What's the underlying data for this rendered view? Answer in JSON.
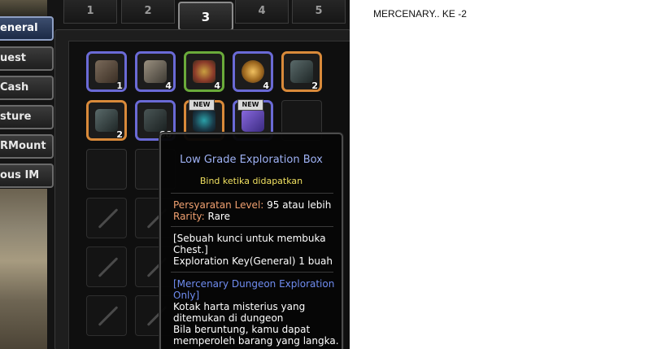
{
  "sidebar": {
    "categories": [
      {
        "label": "eneral",
        "active": true
      },
      {
        "label": "uest"
      },
      {
        "label": "Cash"
      },
      {
        "label": "sture"
      },
      {
        "label": "RMount"
      },
      {
        "label": "ous IM"
      }
    ]
  },
  "tabs": [
    {
      "label": "1"
    },
    {
      "label": "2"
    },
    {
      "label": "3",
      "active": true
    },
    {
      "label": "4"
    },
    {
      "label": "5"
    }
  ],
  "inventory": {
    "row1": [
      {
        "icon": "weapon-box-icon",
        "count": "1",
        "frame": "#6a6ad6"
      },
      {
        "icon": "armor-box-icon",
        "count": "4",
        "frame": "#6a6ad6"
      },
      {
        "icon": "heart-chest-icon",
        "count": "4",
        "frame": "#6aaa3a"
      },
      {
        "icon": "pouch-icon",
        "count": "4",
        "frame": "#6a6ad6"
      },
      {
        "icon": "treasure-chest-icon",
        "count": "2",
        "frame": "#d98a3a"
      }
    ],
    "row2": [
      {
        "icon": "treasure-chest-icon",
        "count": "2",
        "frame": "#d98a3a"
      },
      {
        "icon": "treasure-chest-icon",
        "count": "66",
        "frame": "#6a6ad6"
      },
      {
        "icon": "rune-box-icon",
        "count": "",
        "frame": "#d98a3a",
        "badge": "NEW"
      },
      {
        "icon": "gift-box-icon",
        "count": "",
        "frame": "#6a6ad6",
        "badge": "NEW"
      }
    ]
  },
  "tooltip": {
    "title": "Low Grade Exploration Box",
    "bind": "Bind ketika didapatkan",
    "level_label": "Persyaratan Level:",
    "level_value": "95 atau lebih",
    "rarity_label": "Rarity:",
    "rarity_value": "Rare",
    "desc_1": "[Sebuah kunci untuk membuka",
    "desc_2": "Chest.]",
    "desc_3": "Exploration Key(General) 1 buah",
    "mercenary_1": "[Mercenary Dungeon Exploration",
    "mercenary_2": "Only]",
    "lore_1": "Kotak harta misterius yang",
    "lore_2": "ditemukan di dungeon",
    "lore_3": "Bila beruntung, kamu dapat",
    "lore_4": "memperoleh barang yang langka.",
    "colors": {
      "title": "#9fb2f5",
      "bind": "#f0e060",
      "label": "#f0a070",
      "mercenary": "#6f8cf0"
    }
  },
  "caption": "MERCENARY..  KE -2"
}
